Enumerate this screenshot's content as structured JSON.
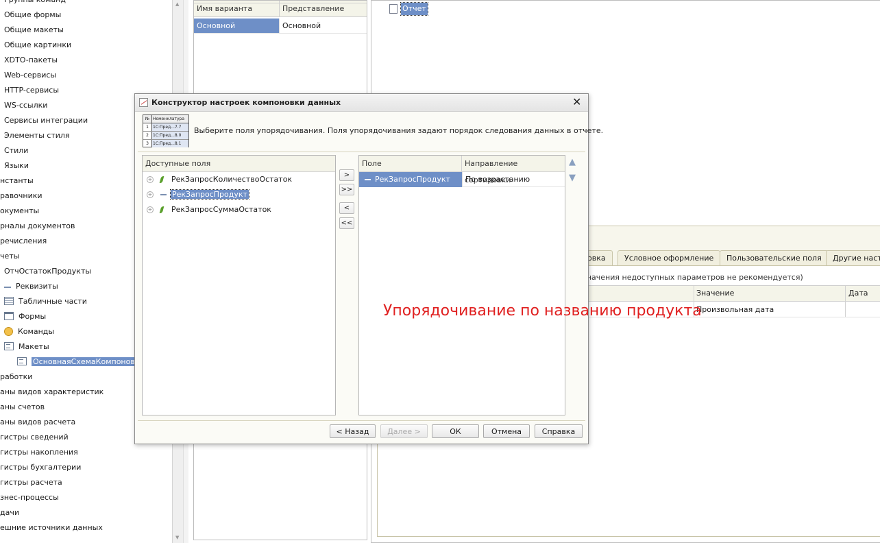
{
  "tree": {
    "items": [
      {
        "label": "Группы команд",
        "indent": 6,
        "icon": ""
      },
      {
        "label": "Общие формы",
        "indent": 6,
        "icon": ""
      },
      {
        "label": "Общие макеты",
        "indent": 6,
        "icon": ""
      },
      {
        "label": "Общие картинки",
        "indent": 6,
        "icon": ""
      },
      {
        "label": "XDTO-пакеты",
        "indent": 6,
        "icon": ""
      },
      {
        "label": "Web-сервисы",
        "indent": 6,
        "icon": ""
      },
      {
        "label": "HTTP-сервисы",
        "indent": 6,
        "icon": ""
      },
      {
        "label": "WS-ссылки",
        "indent": 6,
        "icon": ""
      },
      {
        "label": "Сервисы интеграции",
        "indent": 6,
        "icon": ""
      },
      {
        "label": "Элементы стиля",
        "indent": 6,
        "icon": ""
      },
      {
        "label": "Стили",
        "indent": 6,
        "icon": ""
      },
      {
        "label": "Языки",
        "indent": 6,
        "icon": ""
      },
      {
        "label": "нстанты",
        "indent": 0,
        "icon": ""
      },
      {
        "label": "равочники",
        "indent": 0,
        "icon": ""
      },
      {
        "label": "окументы",
        "indent": 0,
        "icon": ""
      },
      {
        "label": "рналы документов",
        "indent": 0,
        "icon": ""
      },
      {
        "label": "речисления",
        "indent": 0,
        "icon": ""
      },
      {
        "label": "четы",
        "indent": 0,
        "icon": ""
      },
      {
        "label": "ОтчОстатокПродукты",
        "indent": 6,
        "icon": ""
      },
      {
        "label": "Реквизиты",
        "indent": 6,
        "icon": "attr"
      },
      {
        "label": "Табличные части",
        "indent": 6,
        "icon": "table"
      },
      {
        "label": "Формы",
        "indent": 6,
        "icon": "form"
      },
      {
        "label": "Команды",
        "indent": 6,
        "icon": "cmd"
      },
      {
        "label": "Макеты",
        "indent": 6,
        "icon": "layout"
      },
      {
        "label": "ОсновнаяСхемаКомпоновки",
        "indent": 25,
        "icon": "layout",
        "selected": true
      },
      {
        "label": "работки",
        "indent": 0,
        "icon": ""
      },
      {
        "label": "аны видов характеристик",
        "indent": 0,
        "icon": ""
      },
      {
        "label": "аны счетов",
        "indent": 0,
        "icon": ""
      },
      {
        "label": "аны видов расчета",
        "indent": 0,
        "icon": ""
      },
      {
        "label": "гистры сведений",
        "indent": 0,
        "icon": ""
      },
      {
        "label": "гистры накопления",
        "indent": 0,
        "icon": ""
      },
      {
        "label": "гистры бухгалтерии",
        "indent": 0,
        "icon": ""
      },
      {
        "label": "гистры расчета",
        "indent": 0,
        "icon": ""
      },
      {
        "label": "знес-процессы",
        "indent": 0,
        "icon": ""
      },
      {
        "label": "дачи",
        "indent": 0,
        "icon": ""
      },
      {
        "label": "ешние источники данных",
        "indent": 0,
        "icon": ""
      }
    ]
  },
  "variants": {
    "col_name": "Имя варианта",
    "col_presentation": "Представление",
    "row_name": "Основной",
    "row_presentation": "Основной"
  },
  "structure": {
    "report_label": "Отчет"
  },
  "back_panel": {
    "tabs": [
      "ровка",
      "Условное оформление",
      "Пользовательские поля",
      "Другие настр"
    ],
    "warning": "значения недоступных параметров не рекомендуется)",
    "col_value": "Значение",
    "col_date": "Дата",
    "cell_value": "Произвольная дата"
  },
  "dialog": {
    "title": "Конструктор настроек компоновки данных",
    "hint": "Выберите поля упорядочивания. Поля упорядочивания задают порядок следования данных в отчете.",
    "thumb": {
      "head": [
        "№",
        "Номенклатура"
      ],
      "rows": [
        [
          "1",
          "1С:Пред...7.7"
        ],
        [
          "2",
          "1С:Пред...8.0"
        ],
        [
          "3",
          "1С:Пред...8.1"
        ]
      ]
    },
    "available_header": "Доступные поля",
    "available_fields": [
      {
        "label": "РекЗапросКоличествоОстаток",
        "type": "resource"
      },
      {
        "label": "РекЗапросПродукт",
        "type": "dimension",
        "selected": true
      },
      {
        "label": "РекЗапросСуммаОстаток",
        "type": "resource"
      }
    ],
    "move_buttons": [
      ">",
      ">>",
      "<",
      "<<"
    ],
    "order_header_field": "Поле",
    "order_header_direction": "Направление сортировки",
    "order_rows": [
      {
        "field": "РекЗапросПродукт",
        "direction": "По возрастанию"
      }
    ],
    "buttons": {
      "back": "< Назад",
      "next": "Далее >",
      "ok": "ОК",
      "cancel": "Отмена",
      "help": "Справка"
    }
  },
  "annotation": {
    "text": "Упорядочивание по названию продукта",
    "color": "#e02020"
  }
}
